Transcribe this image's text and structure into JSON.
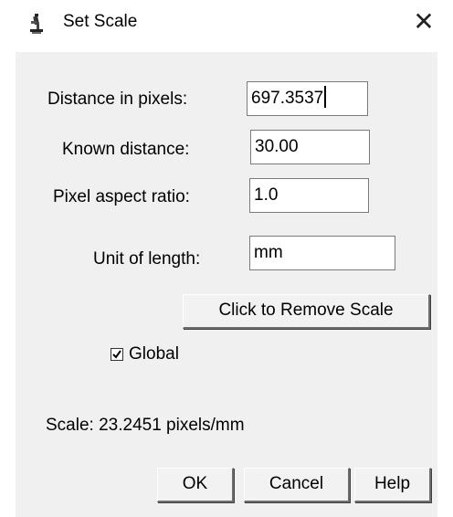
{
  "window": {
    "title": "Set Scale",
    "icon": "microscope-icon",
    "close_glyph": "✕"
  },
  "form": {
    "distance_in_pixels": {
      "label": "Distance in pixels:",
      "value": "697.3537"
    },
    "known_distance": {
      "label": "Known distance:",
      "value": "30.00"
    },
    "pixel_aspect_ratio": {
      "label": "Pixel aspect ratio:",
      "value": "1.0"
    },
    "unit_of_length": {
      "label": "Unit of length:",
      "value": "mm"
    }
  },
  "remove_scale_button": "Click to Remove Scale",
  "global_checkbox": {
    "label": "Global",
    "checked": true
  },
  "scale_text": "Scale: 23.2451 pixels/mm",
  "buttons": {
    "ok": "OK",
    "cancel": "Cancel",
    "help": "Help"
  }
}
